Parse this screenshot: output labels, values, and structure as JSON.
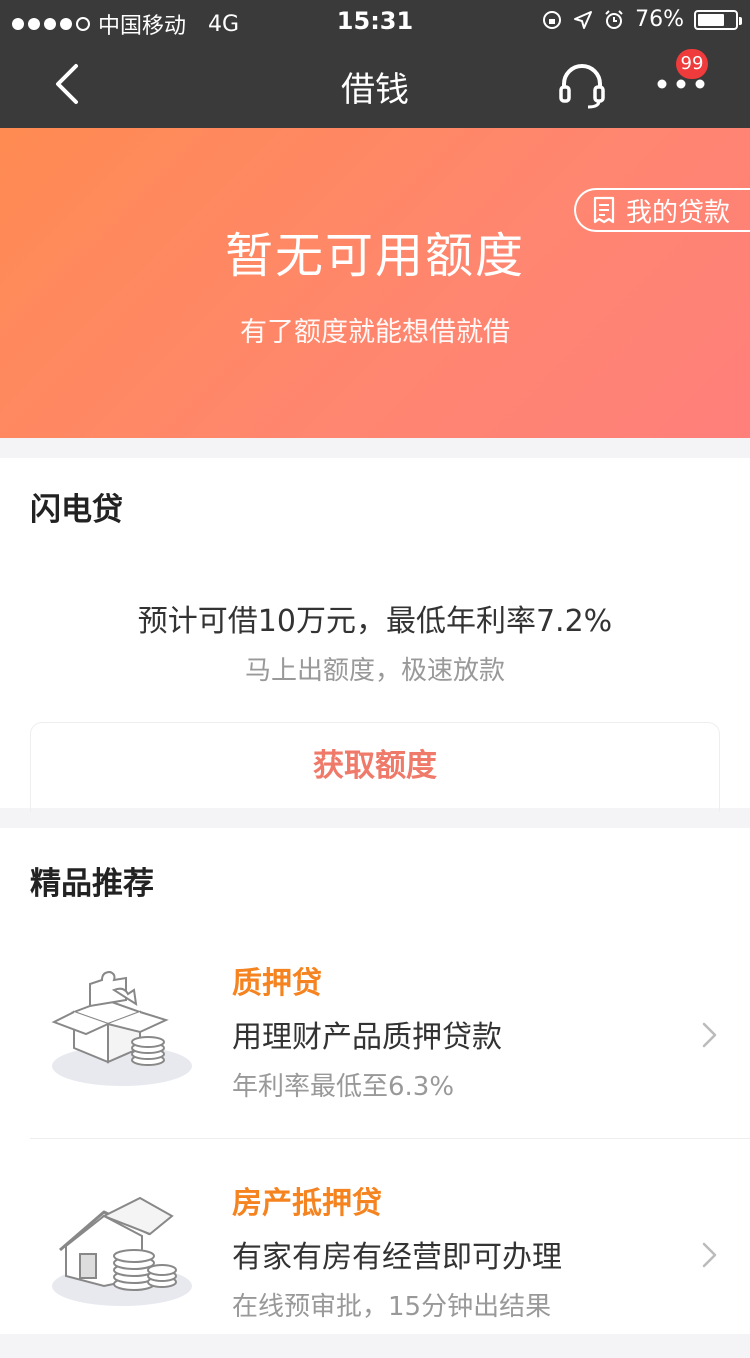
{
  "status_bar": {
    "carrier": "中国移动",
    "network": "4G",
    "time": "15:31",
    "battery": "76%",
    "battery_level": 0.76
  },
  "nav": {
    "title": "借钱",
    "badge": "99"
  },
  "hero": {
    "title": "暂无可用额度",
    "subtitle": "有了额度就能想借就借",
    "my_loan": "我的贷款"
  },
  "flash_loan": {
    "title": "闪电贷",
    "promo": "预计可借10万元，最低年利率7.2%",
    "promo_sub": "马上出额度，极速放款",
    "button": "获取额度"
  },
  "recommend": {
    "title": "精品推荐",
    "items": [
      {
        "name": "质押贷",
        "desc": "用理财产品质押贷款",
        "rate": "年利率最低至6.3%",
        "icon": "box-coins-illustration"
      },
      {
        "name": "房产抵押贷",
        "desc": "有家有房有经营即可办理",
        "rate": "在线预审批，15分钟出结果",
        "icon": "house-coins-illustration"
      }
    ]
  },
  "colors": {
    "nav_bg": "#3a3a3a",
    "hero_start": "#ff8b52",
    "hero_end": "#ff7f7b",
    "accent_orange": "#f5831f",
    "button_text": "#f07a6a"
  }
}
